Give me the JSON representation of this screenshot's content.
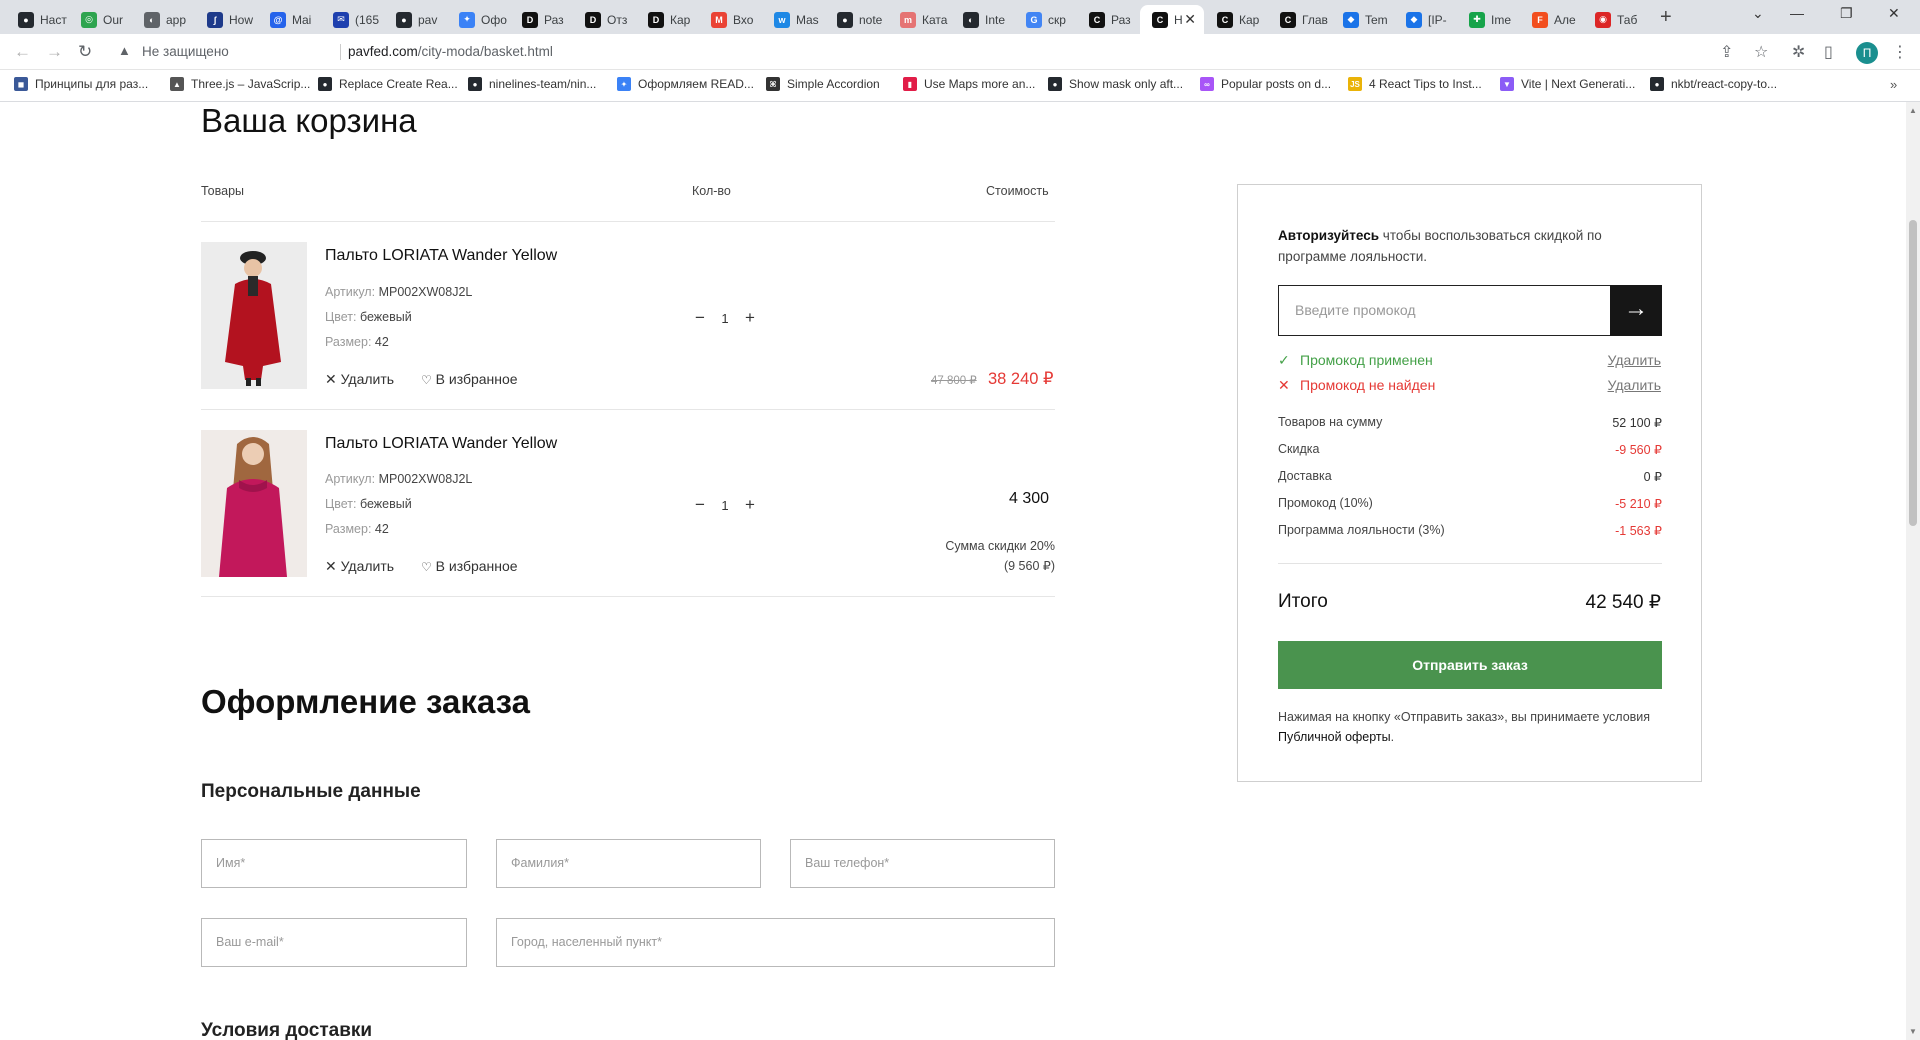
{
  "browser": {
    "tabs": [
      {
        "label": "Наст",
        "color": "#24292f",
        "glyph": "●"
      },
      {
        "label": "Our",
        "color": "#2ea44f",
        "glyph": "◎"
      },
      {
        "label": "app",
        "color": "#5f6368",
        "glyph": "◐"
      },
      {
        "label": "How",
        "color": "#1e3a8a",
        "glyph": "ʃ"
      },
      {
        "label": "Mai",
        "color": "#2563eb",
        "glyph": "@"
      },
      {
        "label": "(165",
        "color": "#1e40af",
        "glyph": "✉"
      },
      {
        "label": "pav",
        "color": "#24292f",
        "glyph": "●"
      },
      {
        "label": "Офо",
        "color": "#3b82f6",
        "glyph": "✦"
      },
      {
        "label": "Раз",
        "color": "#111",
        "glyph": "D"
      },
      {
        "label": "Отз",
        "color": "#111",
        "glyph": "D"
      },
      {
        "label": "Кар",
        "color": "#111",
        "glyph": "D"
      },
      {
        "label": "Вхо",
        "color": "#ea4335",
        "glyph": "M"
      },
      {
        "label": "Mas",
        "color": "#1e88e5",
        "glyph": "w"
      },
      {
        "label": "note",
        "color": "#24292f",
        "glyph": "●"
      },
      {
        "label": "Ката",
        "color": "#e57373",
        "glyph": "m"
      },
      {
        "label": "Inte",
        "color": "#24292f",
        "glyph": "◐"
      },
      {
        "label": "скр",
        "color": "#4285f4",
        "glyph": "G"
      },
      {
        "label": "Раз",
        "color": "#111",
        "glyph": "C"
      },
      {
        "label": "Н",
        "color": "#111",
        "glyph": "C",
        "active": true
      },
      {
        "label": "Кар",
        "color": "#111",
        "glyph": "C"
      },
      {
        "label": "Глав",
        "color": "#111",
        "glyph": "C"
      },
      {
        "label": "Tem",
        "color": "#1a73e8",
        "glyph": "◆"
      },
      {
        "label": "[IP-",
        "color": "#1a73e8",
        "glyph": "◆"
      },
      {
        "label": "Ime",
        "color": "#16a34a",
        "glyph": "✚"
      },
      {
        "label": "Але",
        "color": "#f24e1e",
        "glyph": "F"
      },
      {
        "label": "Таб",
        "color": "#dc2626",
        "glyph": "◉"
      }
    ],
    "insecure_label": "Не защищено",
    "url_host": "pavfed.com",
    "url_path": "/city-moda/basket.html",
    "profile_letter": "П",
    "bookmarks": [
      {
        "label": "Принципы для раз...",
        "color": "#3b5998",
        "glyph": "◼"
      },
      {
        "label": "Three.js – JavaScrip...",
        "color": "#555",
        "glyph": "▲"
      },
      {
        "label": "Replace Create Rea...",
        "color": "#24292f",
        "glyph": "●"
      },
      {
        "label": "ninelines-team/nin...",
        "color": "#24292f",
        "glyph": "●"
      },
      {
        "label": "Оформляем READ...",
        "color": "#3b82f6",
        "glyph": "✦"
      },
      {
        "label": "Simple Accordion",
        "color": "#333",
        "glyph": "⌘"
      },
      {
        "label": "Use Maps more an...",
        "color": "#e11d48",
        "glyph": "▮"
      },
      {
        "label": "Show mask only aft...",
        "color": "#24292f",
        "glyph": "●"
      },
      {
        "label": "Popular posts on d...",
        "color": "#a855f7",
        "glyph": "∞"
      },
      {
        "label": "4 React Tips to Inst...",
        "color": "#eab308",
        "glyph": "JS"
      },
      {
        "label": "Vite | Next Generati...",
        "color": "#8b5cf6",
        "glyph": "▼"
      },
      {
        "label": "nkbt/react-copy-to...",
        "color": "#24292f",
        "glyph": "●"
      }
    ]
  },
  "cart": {
    "title": "Ваша корзина",
    "col_goods": "Товары",
    "col_qty": "Кол-во",
    "col_cost": "Стоимость",
    "items": [
      {
        "name": "Пальто LORIATA Wander Yellow",
        "sku_label": "Артикул:",
        "sku": "MP002XW08J2L",
        "color_label": "Цвет:",
        "color": "бежевый",
        "size_label": "Размер:",
        "size": "42",
        "remove": "Удалить",
        "favorite": "В избранное",
        "qty": "1",
        "price_old": "47 800 ₽",
        "price_new": "38 240 ₽",
        "image_tone": "#b3121f"
      },
      {
        "name": "Пальто LORIATA Wander Yellow",
        "sku_label": "Артикул:",
        "sku": "MP002XW08J2L",
        "color_label": "Цвет:",
        "color": "бежевый",
        "size_label": "Размер:",
        "size": "42",
        "remove": "Удалить",
        "favorite": "В избранное",
        "qty": "1",
        "price": "4 300",
        "discount_line1": "Сумма скидки 20%",
        "discount_line2": "(9 560 ₽)",
        "image_tone": "#c2185b"
      }
    ]
  },
  "checkout": {
    "title": "Оформление заказа",
    "personal_title": "Персональные данные",
    "fields": {
      "first_name": "Имя*",
      "last_name": "Фамилия*",
      "phone": "Ваш телефон*",
      "email": "Ваш e-mail*",
      "city": "Город, населенный пункт*"
    },
    "delivery_title": "Условия доставки"
  },
  "summary": {
    "auth_bold": "Авторизуйтесь",
    "auth_rest": " чтобы воспользоваться скидкой по программе лояльности.",
    "promo_placeholder": "Введите промокод",
    "promo_ok": "Промокод применен",
    "promo_fail": "Промокод не найден",
    "promo_remove": "Удалить",
    "rows": [
      {
        "label": "Товаров на сумму",
        "value": "52 100 ₽",
        "red": false
      },
      {
        "label": "Скидка",
        "value": "-9 560 ₽",
        "red": true
      },
      {
        "label": "Доставка",
        "value": "0 ₽",
        "red": false
      },
      {
        "label": "Промокод (10%)",
        "value": "-5 210 ₽",
        "red": true
      },
      {
        "label": "Программа лояльности (3%)",
        "value": "-1 563 ₽",
        "red": true
      }
    ],
    "total_label": "Итого",
    "total_value": "42 540 ₽",
    "submit_label": "Отправить заказ",
    "terms_text": "Нажимая на кнопку «Отправить заказ», вы принимаете условия ",
    "terms_link": "Публичной оферты",
    "terms_end": ".",
    "ok_color": "#43a047",
    "error_color": "#e53935",
    "accent_green": "#4a934e"
  }
}
